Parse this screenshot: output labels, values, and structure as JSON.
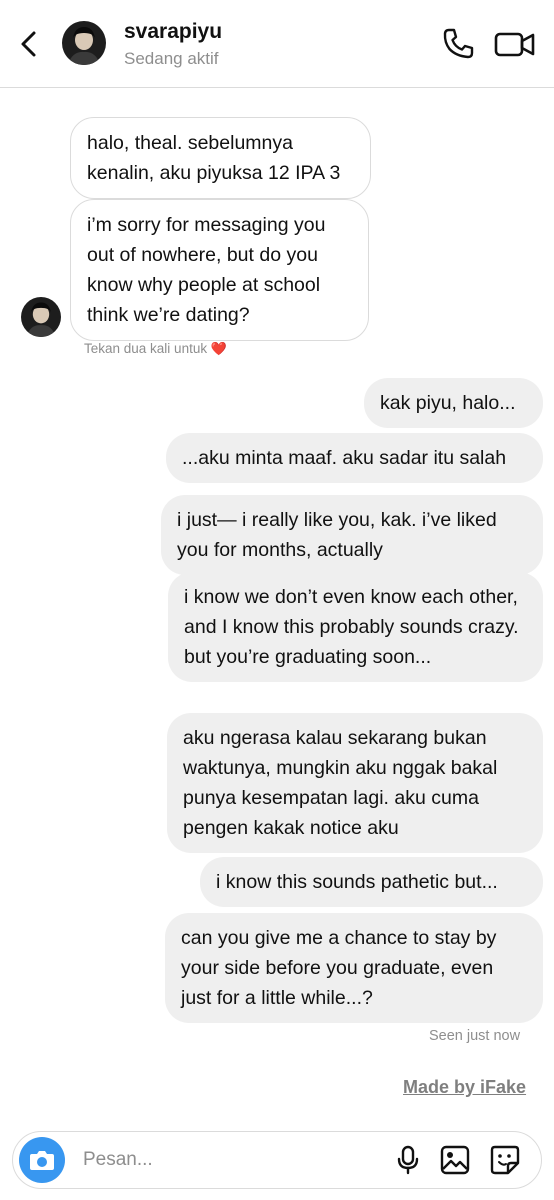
{
  "header": {
    "username": "svarapiyu",
    "status": "Sedang aktif",
    "icons": [
      "back-arrow-icon",
      "phone-icon",
      "video-camera-icon"
    ]
  },
  "messages": [
    {
      "side": "in",
      "text": "halo, theal. sebelumnya kenalin, aku piyuksa 12 IPA 3"
    },
    {
      "side": "in",
      "text": "i’m sorry for messaging you out of nowhere, but do you know why people at school think we’re dating?"
    },
    {
      "side": "out",
      "text": "kak piyu, halo..."
    },
    {
      "side": "out",
      "text": "...aku minta maaf. aku sadar itu salah"
    },
    {
      "side": "out",
      "text": "i just— i really like you, kak. i’ve liked you for months, actually"
    },
    {
      "side": "out",
      "text": "i know we don’t even know each other, and I know this probably sounds crazy. but you’re graduating soon..."
    },
    {
      "side": "out",
      "text": "aku ngerasa kalau sekarang bukan waktunya, mungkin aku nggak bakal punya kesempatan lagi. aku cuma pengen kakak notice aku"
    },
    {
      "side": "out",
      "text": "i know this sounds pathetic but..."
    },
    {
      "side": "out",
      "text": "can you give me a chance to stay by your side before you graduate, even just for a little while...?"
    }
  ],
  "double_tap_hint": "Tekan dua kali untuk",
  "heart": "❤️",
  "seen_text": "Seen just now",
  "watermark": "Made by iFake",
  "composer": {
    "placeholder": "Pesan...",
    "icons": [
      "camera-icon",
      "microphone-icon",
      "gallery-icon",
      "sticker-icon"
    ]
  },
  "colors": {
    "accent": "#3897f0",
    "incoming_border": "#dbdbdb",
    "outgoing_bg": "#efefef",
    "secondary_text": "#8e8e8e",
    "heart": "#ed2c36"
  }
}
